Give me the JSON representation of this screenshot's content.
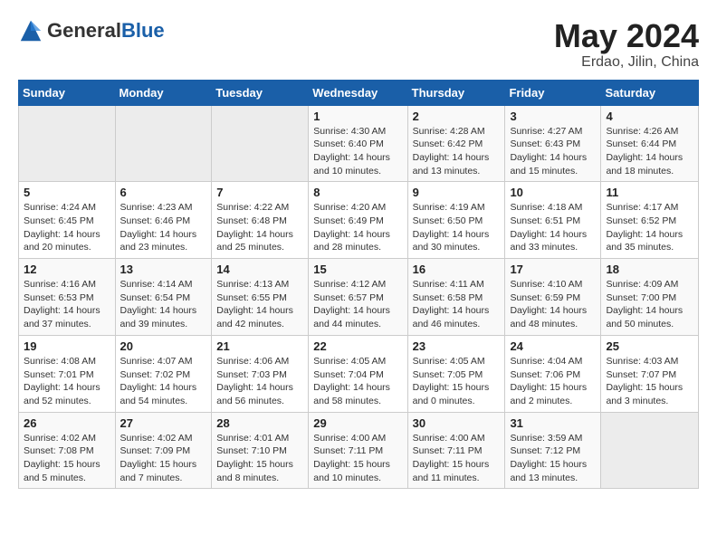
{
  "header": {
    "logo_general": "General",
    "logo_blue": "Blue",
    "title": "May 2024",
    "subtitle": "Erdao, Jilin, China"
  },
  "days_of_week": [
    "Sunday",
    "Monday",
    "Tuesday",
    "Wednesday",
    "Thursday",
    "Friday",
    "Saturday"
  ],
  "weeks": [
    [
      {
        "num": "",
        "info": ""
      },
      {
        "num": "",
        "info": ""
      },
      {
        "num": "",
        "info": ""
      },
      {
        "num": "1",
        "info": "Sunrise: 4:30 AM\nSunset: 6:40 PM\nDaylight: 14 hours\nand 10 minutes."
      },
      {
        "num": "2",
        "info": "Sunrise: 4:28 AM\nSunset: 6:42 PM\nDaylight: 14 hours\nand 13 minutes."
      },
      {
        "num": "3",
        "info": "Sunrise: 4:27 AM\nSunset: 6:43 PM\nDaylight: 14 hours\nand 15 minutes."
      },
      {
        "num": "4",
        "info": "Sunrise: 4:26 AM\nSunset: 6:44 PM\nDaylight: 14 hours\nand 18 minutes."
      }
    ],
    [
      {
        "num": "5",
        "info": "Sunrise: 4:24 AM\nSunset: 6:45 PM\nDaylight: 14 hours\nand 20 minutes."
      },
      {
        "num": "6",
        "info": "Sunrise: 4:23 AM\nSunset: 6:46 PM\nDaylight: 14 hours\nand 23 minutes."
      },
      {
        "num": "7",
        "info": "Sunrise: 4:22 AM\nSunset: 6:48 PM\nDaylight: 14 hours\nand 25 minutes."
      },
      {
        "num": "8",
        "info": "Sunrise: 4:20 AM\nSunset: 6:49 PM\nDaylight: 14 hours\nand 28 minutes."
      },
      {
        "num": "9",
        "info": "Sunrise: 4:19 AM\nSunset: 6:50 PM\nDaylight: 14 hours\nand 30 minutes."
      },
      {
        "num": "10",
        "info": "Sunrise: 4:18 AM\nSunset: 6:51 PM\nDaylight: 14 hours\nand 33 minutes."
      },
      {
        "num": "11",
        "info": "Sunrise: 4:17 AM\nSunset: 6:52 PM\nDaylight: 14 hours\nand 35 minutes."
      }
    ],
    [
      {
        "num": "12",
        "info": "Sunrise: 4:16 AM\nSunset: 6:53 PM\nDaylight: 14 hours\nand 37 minutes."
      },
      {
        "num": "13",
        "info": "Sunrise: 4:14 AM\nSunset: 6:54 PM\nDaylight: 14 hours\nand 39 minutes."
      },
      {
        "num": "14",
        "info": "Sunrise: 4:13 AM\nSunset: 6:55 PM\nDaylight: 14 hours\nand 42 minutes."
      },
      {
        "num": "15",
        "info": "Sunrise: 4:12 AM\nSunset: 6:57 PM\nDaylight: 14 hours\nand 44 minutes."
      },
      {
        "num": "16",
        "info": "Sunrise: 4:11 AM\nSunset: 6:58 PM\nDaylight: 14 hours\nand 46 minutes."
      },
      {
        "num": "17",
        "info": "Sunrise: 4:10 AM\nSunset: 6:59 PM\nDaylight: 14 hours\nand 48 minutes."
      },
      {
        "num": "18",
        "info": "Sunrise: 4:09 AM\nSunset: 7:00 PM\nDaylight: 14 hours\nand 50 minutes."
      }
    ],
    [
      {
        "num": "19",
        "info": "Sunrise: 4:08 AM\nSunset: 7:01 PM\nDaylight: 14 hours\nand 52 minutes."
      },
      {
        "num": "20",
        "info": "Sunrise: 4:07 AM\nSunset: 7:02 PM\nDaylight: 14 hours\nand 54 minutes."
      },
      {
        "num": "21",
        "info": "Sunrise: 4:06 AM\nSunset: 7:03 PM\nDaylight: 14 hours\nand 56 minutes."
      },
      {
        "num": "22",
        "info": "Sunrise: 4:05 AM\nSunset: 7:04 PM\nDaylight: 14 hours\nand 58 minutes."
      },
      {
        "num": "23",
        "info": "Sunrise: 4:05 AM\nSunset: 7:05 PM\nDaylight: 15 hours\nand 0 minutes."
      },
      {
        "num": "24",
        "info": "Sunrise: 4:04 AM\nSunset: 7:06 PM\nDaylight: 15 hours\nand 2 minutes."
      },
      {
        "num": "25",
        "info": "Sunrise: 4:03 AM\nSunset: 7:07 PM\nDaylight: 15 hours\nand 3 minutes."
      }
    ],
    [
      {
        "num": "26",
        "info": "Sunrise: 4:02 AM\nSunset: 7:08 PM\nDaylight: 15 hours\nand 5 minutes."
      },
      {
        "num": "27",
        "info": "Sunrise: 4:02 AM\nSunset: 7:09 PM\nDaylight: 15 hours\nand 7 minutes."
      },
      {
        "num": "28",
        "info": "Sunrise: 4:01 AM\nSunset: 7:10 PM\nDaylight: 15 hours\nand 8 minutes."
      },
      {
        "num": "29",
        "info": "Sunrise: 4:00 AM\nSunset: 7:11 PM\nDaylight: 15 hours\nand 10 minutes."
      },
      {
        "num": "30",
        "info": "Sunrise: 4:00 AM\nSunset: 7:11 PM\nDaylight: 15 hours\nand 11 minutes."
      },
      {
        "num": "31",
        "info": "Sunrise: 3:59 AM\nSunset: 7:12 PM\nDaylight: 15 hours\nand 13 minutes."
      },
      {
        "num": "",
        "info": ""
      }
    ]
  ]
}
